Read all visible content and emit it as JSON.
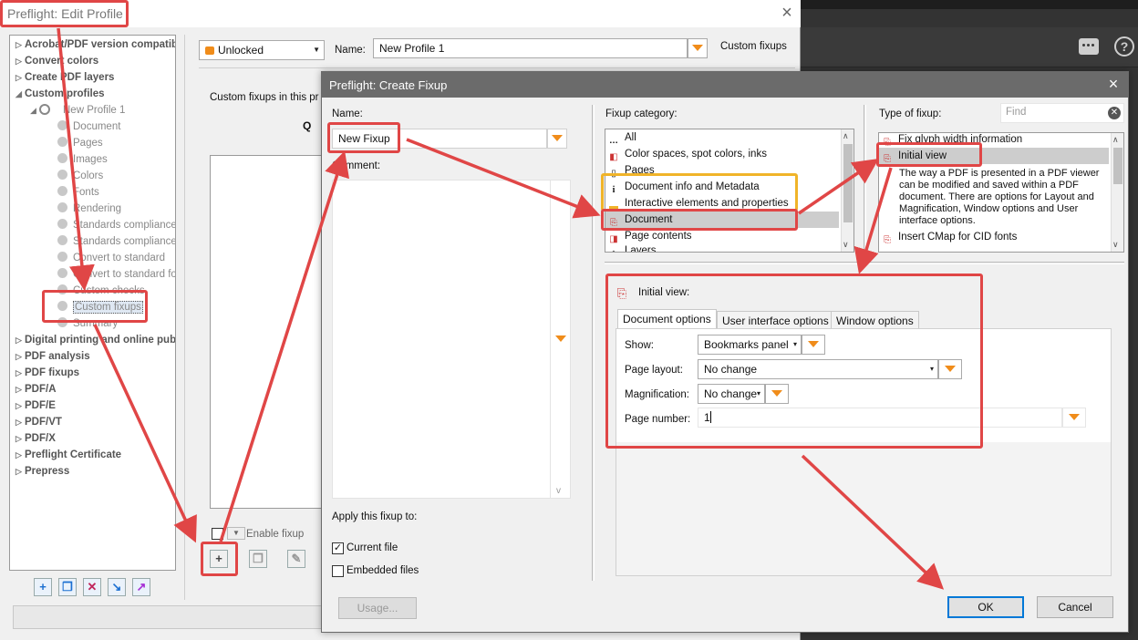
{
  "edit_profile": {
    "title": "Preflight: Edit Profile",
    "close": "×",
    "lock_label": "Unlocked",
    "name_label": "Name:",
    "name_value": "New Profile 1",
    "section_label": "Custom fixups",
    "custom_fixups_caption": "Custom fixups in this pr",
    "search_icon": "Q",
    "enable_fixup_label": "Enable fixup",
    "tree": [
      {
        "label": "Acrobat/PDF version compatibi"
      },
      {
        "label": "Convert colors"
      },
      {
        "label": "Create PDF layers"
      },
      {
        "label": "Custom profiles"
      },
      {
        "label": "New Profile 1"
      },
      {
        "label": "Document"
      },
      {
        "label": "Pages"
      },
      {
        "label": "Images"
      },
      {
        "label": "Colors"
      },
      {
        "label": "Fonts"
      },
      {
        "label": "Rendering"
      },
      {
        "label": "Standards compliance"
      },
      {
        "label": "Standards compliance"
      },
      {
        "label": "Convert to standard"
      },
      {
        "label": "Convert to standard fo"
      },
      {
        "label": "Custom checks"
      },
      {
        "label": "Custom fixups"
      },
      {
        "label": "Summary"
      },
      {
        "label": "Digital printing and online pub"
      },
      {
        "label": "PDF analysis"
      },
      {
        "label": "PDF fixups"
      },
      {
        "label": "PDF/A"
      },
      {
        "label": "PDF/E"
      },
      {
        "label": "PDF/VT"
      },
      {
        "label": "PDF/X"
      },
      {
        "label": "Preflight Certificate"
      },
      {
        "label": "Prepress"
      }
    ]
  },
  "create_fixup": {
    "title": "Preflight: Create Fixup",
    "close": "×",
    "name_label": "Name:",
    "name_value": "New Fixup",
    "comment_label": "Comment:",
    "apply_label": "Apply this fixup to:",
    "current_file_label": "Current file",
    "current_file_checked": true,
    "embedded_files_label": "Embedded files",
    "embedded_files_checked": false,
    "usage_button": "Usage...",
    "ok_button": "OK",
    "cancel_button": "Cancel",
    "category_label": "Fixup category:",
    "categories": [
      "All",
      "Color spaces, spot colors, inks",
      "Pages",
      "Document info and Metadata",
      "Interactive elements and properties",
      "Document",
      "Page contents",
      "Layers"
    ],
    "selected_category": "Document",
    "type_label": "Type of fixup:",
    "find_placeholder": "Find",
    "types": [
      "Fix glyph width information",
      "Initial view",
      "Insert CMap for CID fonts"
    ],
    "selected_type": "Initial view",
    "type_description": "The way a PDF is presented in a PDF viewer can be modified and saved within a PDF document. There are options for Layout and Magnification, Window options and User interface options.",
    "detail_title": "Initial view:",
    "tabs": [
      "Document options",
      "User interface options",
      "Window options"
    ],
    "active_tab": "Document options",
    "show_label": "Show:",
    "show_value": "Bookmarks panel",
    "page_layout_label": "Page layout:",
    "page_layout_value": "No change",
    "magnification_label": "Magnification:",
    "magnification_value": "No change",
    "page_number_label": "Page number:",
    "page_number_value": "1"
  },
  "annotation_colors": {
    "highlight": "#e04646",
    "secondary": "#f0b429"
  },
  "app": {
    "help_icon": "?",
    "chat_icon": "chat-icon"
  }
}
